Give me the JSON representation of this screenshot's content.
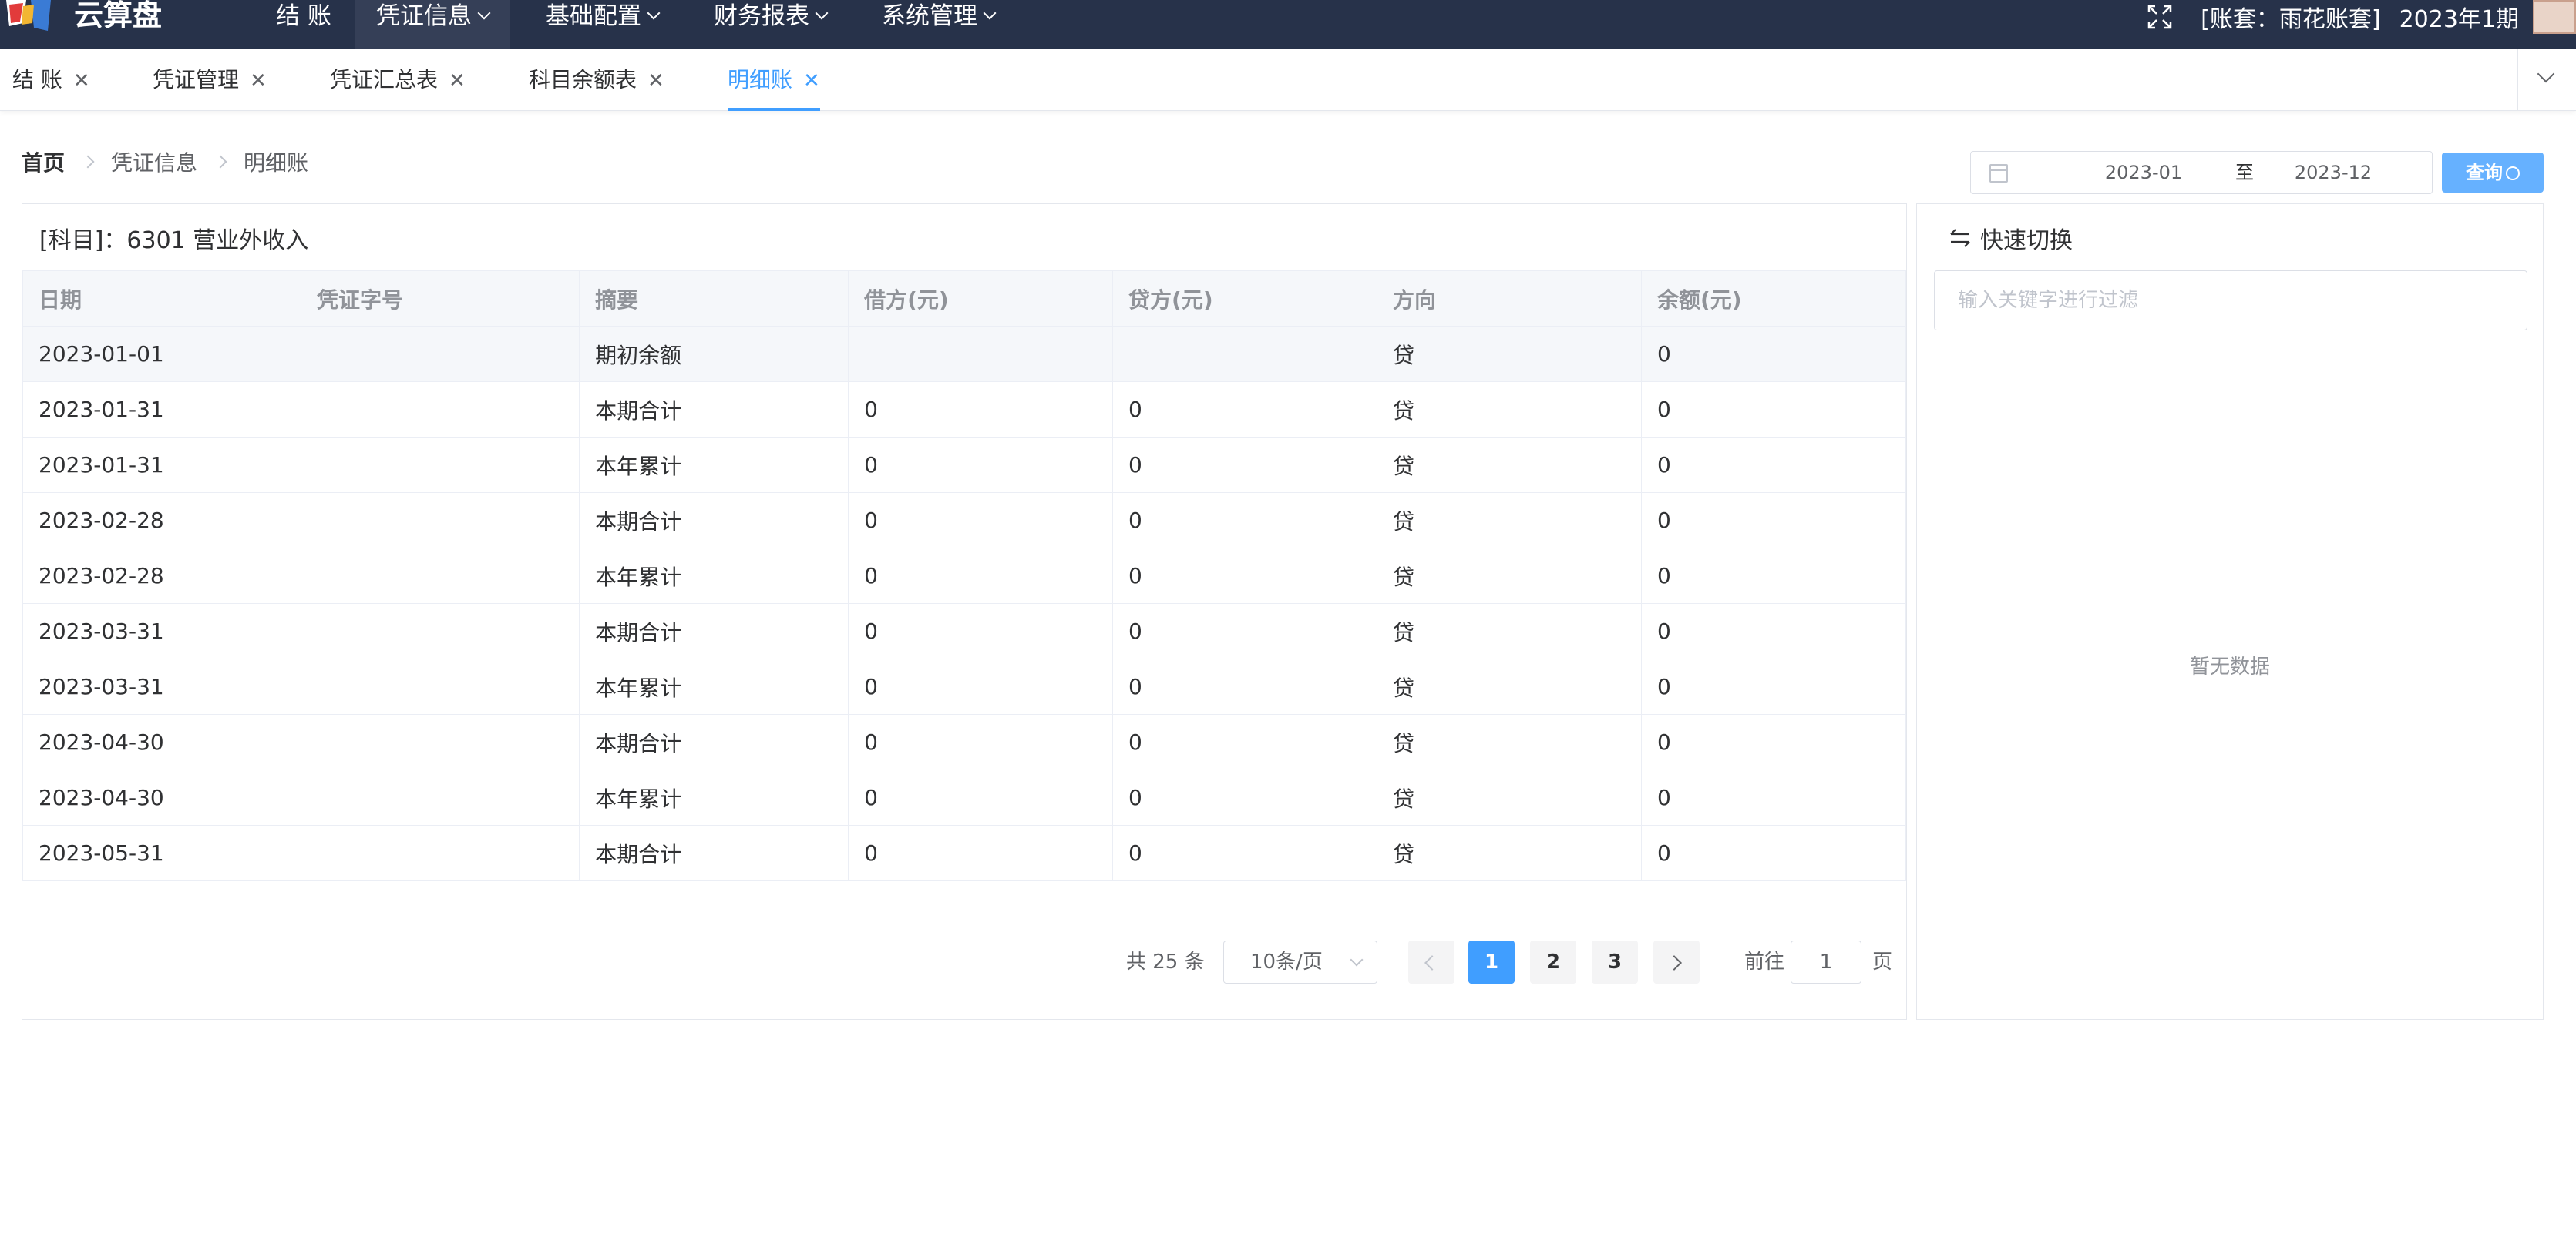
{
  "app": {
    "name": "云算盘"
  },
  "nav": [
    {
      "label": "结 账",
      "dropdown": false,
      "active": false
    },
    {
      "label": "凭证信息",
      "dropdown": true,
      "active": true
    },
    {
      "label": "基础配置",
      "dropdown": true,
      "active": false
    },
    {
      "label": "财务报表",
      "dropdown": true,
      "active": false
    },
    {
      "label": "系统管理",
      "dropdown": true,
      "active": false
    }
  ],
  "header": {
    "account": "[账套：雨花账套]",
    "period": "2023年1期"
  },
  "tabs": [
    {
      "label": "结 账",
      "active": false
    },
    {
      "label": "凭证管理",
      "active": false
    },
    {
      "label": "凭证汇总表",
      "active": false
    },
    {
      "label": "科目余额表",
      "active": false
    },
    {
      "label": "明细账",
      "active": true
    }
  ],
  "breadcrumb": [
    "首页",
    "凭证信息",
    "明细账"
  ],
  "date_range": {
    "start": "2023-01",
    "separator": "至",
    "end": "2023-12"
  },
  "query_button": "查询",
  "subject": "[科目]：6301 营业外收入",
  "table": {
    "columns": [
      "日期",
      "凭证字号",
      "摘要",
      "借方(元)",
      "贷方(元)",
      "方向",
      "余额(元)"
    ],
    "rows": [
      [
        "2023-01-01",
        "",
        "期初余额",
        "",
        "",
        "贷",
        "0"
      ],
      [
        "2023-01-31",
        "",
        "本期合计",
        "0",
        "0",
        "贷",
        "0"
      ],
      [
        "2023-01-31",
        "",
        "本年累计",
        "0",
        "0",
        "贷",
        "0"
      ],
      [
        "2023-02-28",
        "",
        "本期合计",
        "0",
        "0",
        "贷",
        "0"
      ],
      [
        "2023-02-28",
        "",
        "本年累计",
        "0",
        "0",
        "贷",
        "0"
      ],
      [
        "2023-03-31",
        "",
        "本期合计",
        "0",
        "0",
        "贷",
        "0"
      ],
      [
        "2023-03-31",
        "",
        "本年累计",
        "0",
        "0",
        "贷",
        "0"
      ],
      [
        "2023-04-30",
        "",
        "本期合计",
        "0",
        "0",
        "贷",
        "0"
      ],
      [
        "2023-04-30",
        "",
        "本年累计",
        "0",
        "0",
        "贷",
        "0"
      ],
      [
        "2023-05-31",
        "",
        "本期合计",
        "0",
        "0",
        "贷",
        "0"
      ]
    ]
  },
  "pagination": {
    "total": "共 25 条",
    "page_size": "10条/页",
    "pages": [
      "1",
      "2",
      "3"
    ],
    "current": "1",
    "goto_label": "前往",
    "goto_value": "1",
    "page_suffix": "页"
  },
  "side_panel": {
    "title": "快速切换",
    "filter_placeholder": "输入关键字进行过滤",
    "empty_text": "暂无数据"
  },
  "colors": {
    "nav_bg": "#27324a",
    "accent": "#409eff",
    "query_button": "#66b1ff"
  }
}
